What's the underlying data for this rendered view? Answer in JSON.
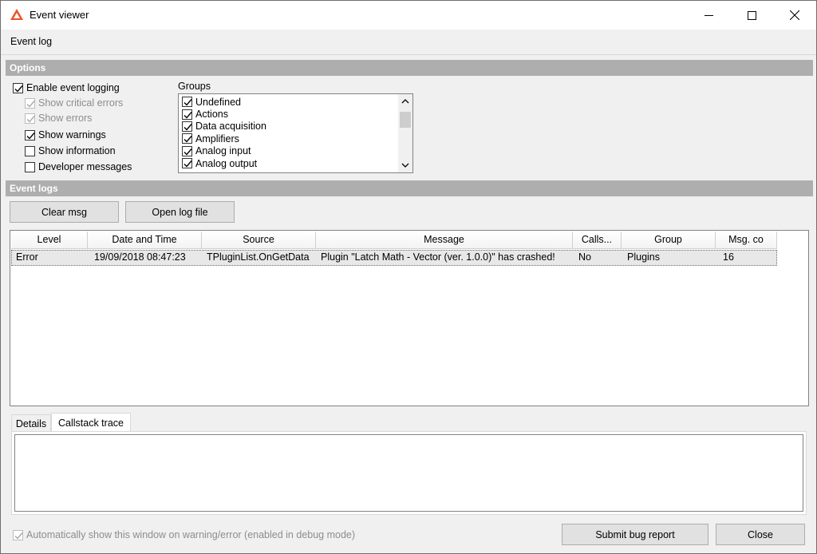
{
  "window": {
    "title": "Event viewer",
    "icon": "triangle-logo-icon",
    "accent": "#e8542a"
  },
  "menu": {
    "items": [
      "Event log"
    ]
  },
  "options": {
    "header": "Options",
    "enable_logging": {
      "label": "Enable event logging",
      "checked": true
    },
    "show_critical": {
      "label": "Show critical errors",
      "checked": true,
      "disabled": true
    },
    "show_errors": {
      "label": "Show errors",
      "checked": true,
      "disabled": true
    },
    "show_warnings": {
      "label": "Show warnings",
      "checked": true
    },
    "show_information": {
      "label": "Show information",
      "checked": false
    },
    "developer_messages": {
      "label": "Developer messages",
      "checked": false
    },
    "groups_label": "Groups",
    "groups": [
      "Undefined",
      "Actions",
      "Data acquisition",
      "Amplifiers",
      "Analog input",
      "Analog output"
    ]
  },
  "event_logs": {
    "header": "Event logs",
    "clear_button": "Clear msg",
    "open_button": "Open log file",
    "columns": [
      "Level",
      "Date and Time",
      "Source",
      "Message",
      "Calls...",
      "Group",
      "Msg. co"
    ],
    "rows": [
      [
        "Error",
        "19/09/2018 08:47:23",
        "TPluginList.OnGetData",
        "Plugin \"Latch Math - Vector (ver. 1.0.0)\" has crashed!",
        "No",
        "Plugins",
        "16"
      ]
    ]
  },
  "tabs": {
    "details": "Details",
    "callstack": "Callstack trace",
    "active": "Callstack trace"
  },
  "footer": {
    "auto_show_label": "Automatically show this window on warning/error (enabled in debug mode)",
    "auto_show_checked": true,
    "submit_button": "Submit bug report",
    "close_button": "Close"
  }
}
